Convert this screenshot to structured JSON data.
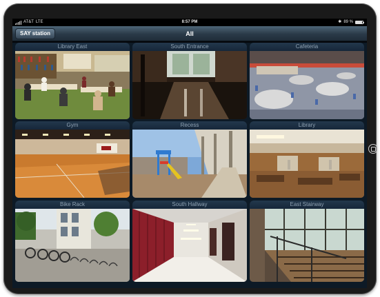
{
  "status": {
    "carrier": "AT&T",
    "network": "LTE",
    "time": "8:57 PM",
    "battery": "89 %"
  },
  "navbar": {
    "back_label": "SAY station",
    "title": "All"
  },
  "cameras": [
    {
      "label": "Library East"
    },
    {
      "label": "South Entrance"
    },
    {
      "label": "Cafeteria"
    },
    {
      "label": "Gym"
    },
    {
      "label": "Recess"
    },
    {
      "label": "Library"
    },
    {
      "label": "Bike Rack"
    },
    {
      "label": "South Hallway"
    },
    {
      "label": "East Stairway"
    }
  ]
}
